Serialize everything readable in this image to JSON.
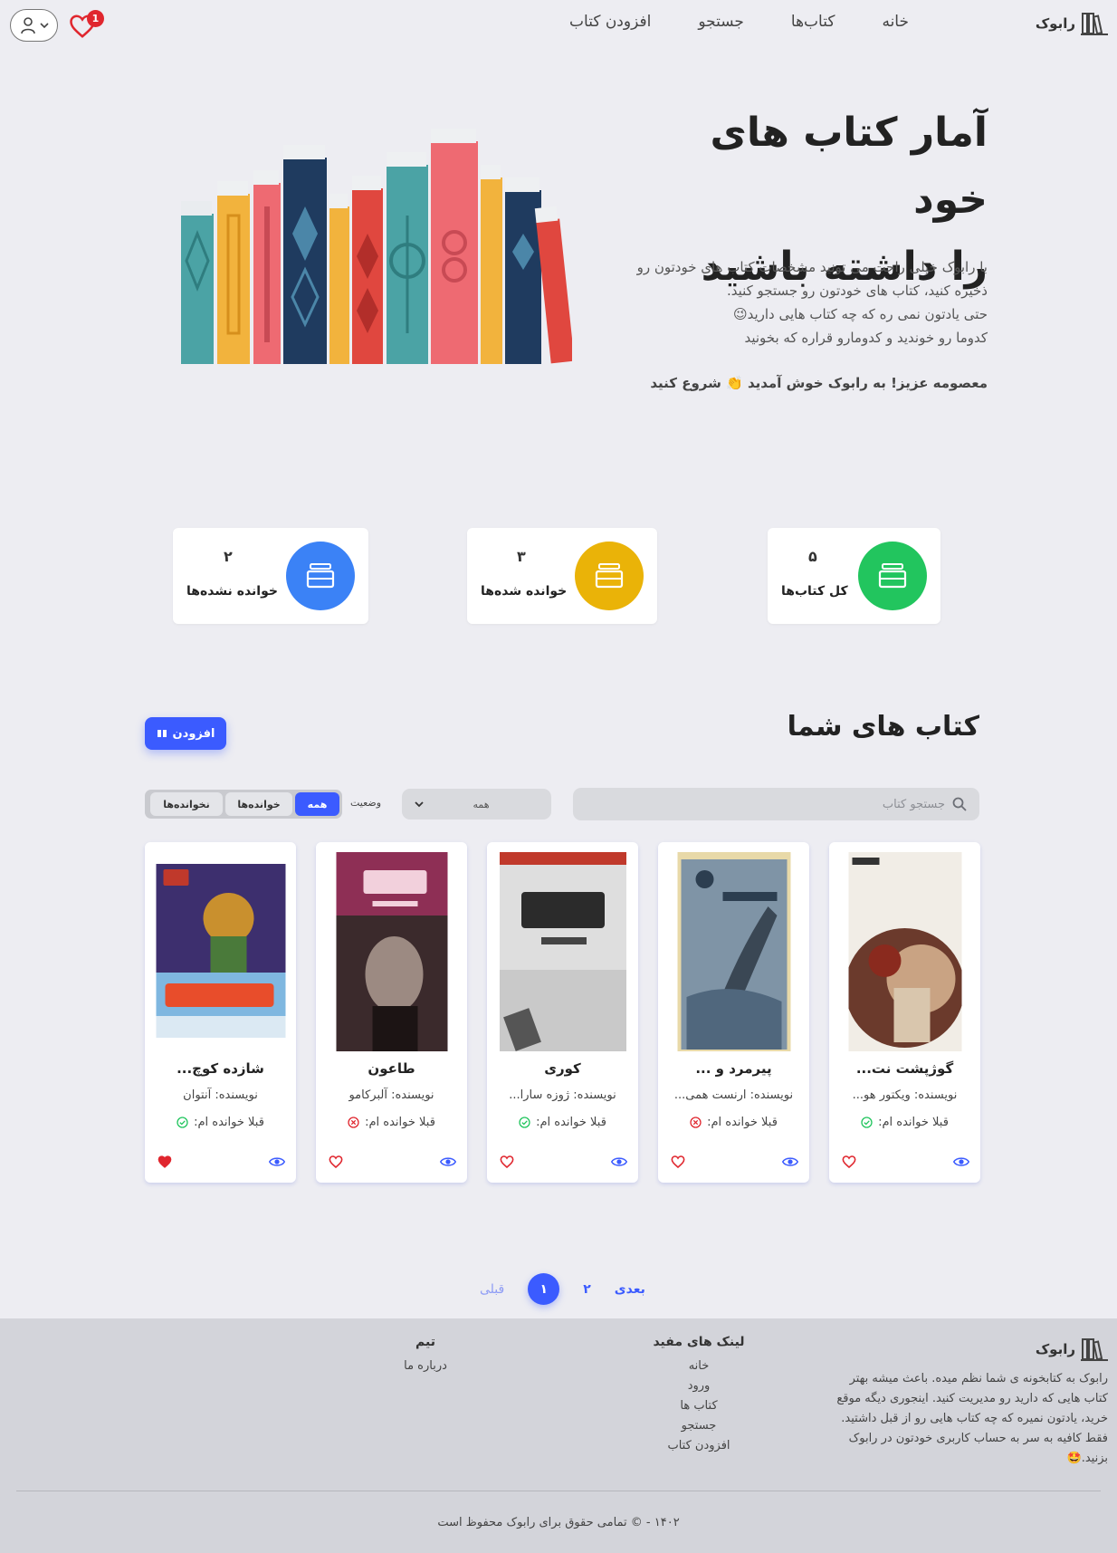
{
  "nav": {
    "brand": "رابوک",
    "links": [
      "خانه",
      "کتاب‌ها",
      "جستجو",
      "افزودن کتاب"
    ],
    "wishlist_count": "1"
  },
  "hero": {
    "title_line1": "آمار کتاب های خود",
    "title_line2": "را داشته باشید",
    "desc_line1": "با رابوک خیلی راحت می تونید مشخصات کتاب های خودتون رو",
    "desc_line2": "ذخیره کنید، کتاب های خودتون رو جستجو کنید.",
    "desc_line3": "حتی یادتون نمی ره که چه کتاب هایی دارید😉",
    "desc_line4": "کدوما رو خوندید و کدومارو قراره که بخونید",
    "welcome": "معصومه عزیز! به رابوک خوش آمدید 👏 شروع کنید"
  },
  "stats": [
    {
      "label": "کل کتاب‌ها",
      "value": "۵",
      "color": "#22c55e"
    },
    {
      "label": "خوانده شده‌ها",
      "value": "۳",
      "color": "#eab308"
    },
    {
      "label": "خوانده نشده‌ها",
      "value": "۲",
      "color": "#3b82f6"
    }
  ],
  "section": {
    "title": "کتاب های شما",
    "add_button": "افزودن"
  },
  "filters": {
    "search_placeholder": "جستجو کتاب",
    "select_value": "همه",
    "status_label": "وضعیت",
    "segments": [
      "همه",
      "خوانده‌ها",
      "نخوانده‌ها"
    ],
    "active_segment": "همه"
  },
  "books": [
    {
      "title": "گوژپشت نت...",
      "author": "نویسنده: ویکتور هو...",
      "read_label": "قبلا خوانده ام:",
      "read": true,
      "favorite": false
    },
    {
      "title": "پیرمرد و ...",
      "author": "نویسنده: ارنست همی...",
      "read_label": "قبلا خوانده ام:",
      "read": false,
      "favorite": false
    },
    {
      "title": "کوری",
      "author": "نویسنده: ژوزه سارا...",
      "read_label": "قبلا خوانده ام:",
      "read": true,
      "favorite": false
    },
    {
      "title": "طاعون",
      "author": "نویسنده: آلبرکامو",
      "read_label": "قبلا خوانده ام:",
      "read": false,
      "favorite": false
    },
    {
      "title": "شازده کوچ...",
      "author": "نویسنده: آنتوان",
      "read_label": "قبلا خوانده ام:",
      "read": true,
      "favorite": true
    }
  ],
  "pagination": {
    "prev": "قبلی",
    "next": "بعدی",
    "pages": [
      "۱",
      "۲"
    ],
    "current": "۱"
  },
  "footer": {
    "brand": "رابوک",
    "desc": "رابوک به کتابخونه ی شما نظم میده. باعث میشه بهتر کتاب هایی که دارید رو مدیریت کنید. اینجوری دیگه موقع خرید، یادتون نمیره که چه کتاب هایی رو از قبل داشتید. فقط کافیه به سر به حساب کاربری خودتون در رابوک بزنید.🤩",
    "links_title": "لینک های مفید",
    "links": [
      "خانه",
      "ورود",
      "کتاب ها",
      "جستجو",
      "افزودن کتاب"
    ],
    "team_title": "تیم",
    "team_links": [
      "درباره ما"
    ],
    "copyright": "۱۴۰۲ - © تمامی حقوق برای رابوک محفوظ است"
  },
  "colors": {
    "accent": "#3b5bff",
    "background": "#ededf2",
    "footer": "#d3d4da"
  }
}
